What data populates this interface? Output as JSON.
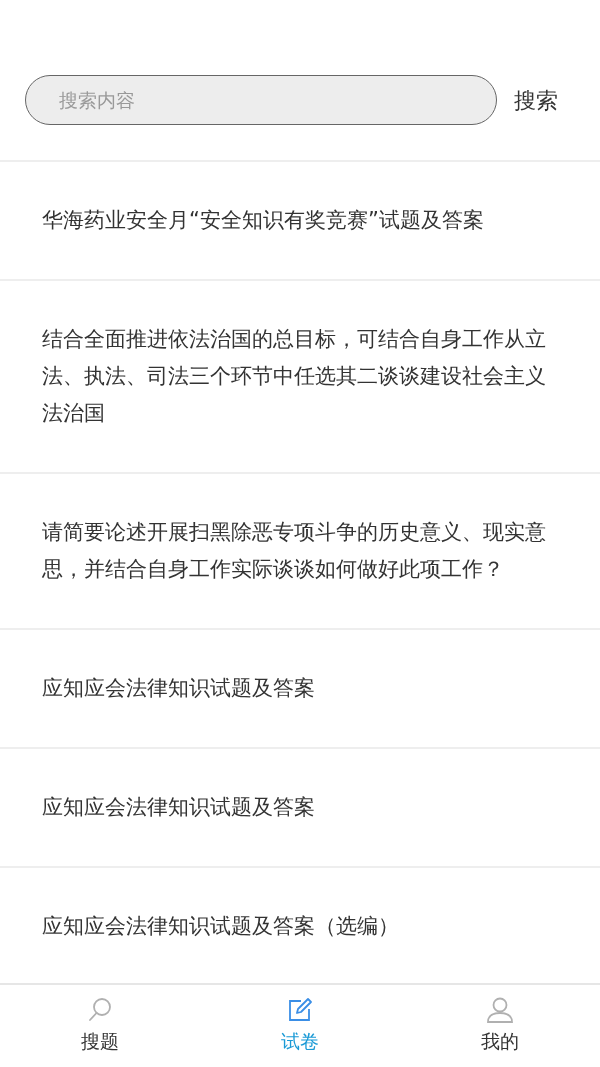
{
  "search": {
    "placeholder": "搜索内容",
    "button": "搜索"
  },
  "items": [
    {
      "title": "华海药业安全月“安全知识有奖竞赛”试题及答案"
    },
    {
      "title": "结合全面推进依法治国的总目标，可结合自身工作从立法、执法、司法三个环节中任选其二谈谈建设社会主义法治国"
    },
    {
      "title": "请简要论述开展扫黑除恶专项斗争的历史意义、现实意思，并结合自身工作实际谈谈如何做好此项工作？"
    },
    {
      "title": "应知应会法律知识试题及答案"
    },
    {
      "title": "应知应会法律知识试题及答案"
    },
    {
      "title": "应知应会法律知识试题及答案（选编）"
    }
  ],
  "tabs": [
    {
      "label": "搜题",
      "kind": "search",
      "selected": false
    },
    {
      "label": "试卷",
      "kind": "edit",
      "selected": true
    },
    {
      "label": "我的",
      "kind": "user",
      "selected": false
    }
  ]
}
